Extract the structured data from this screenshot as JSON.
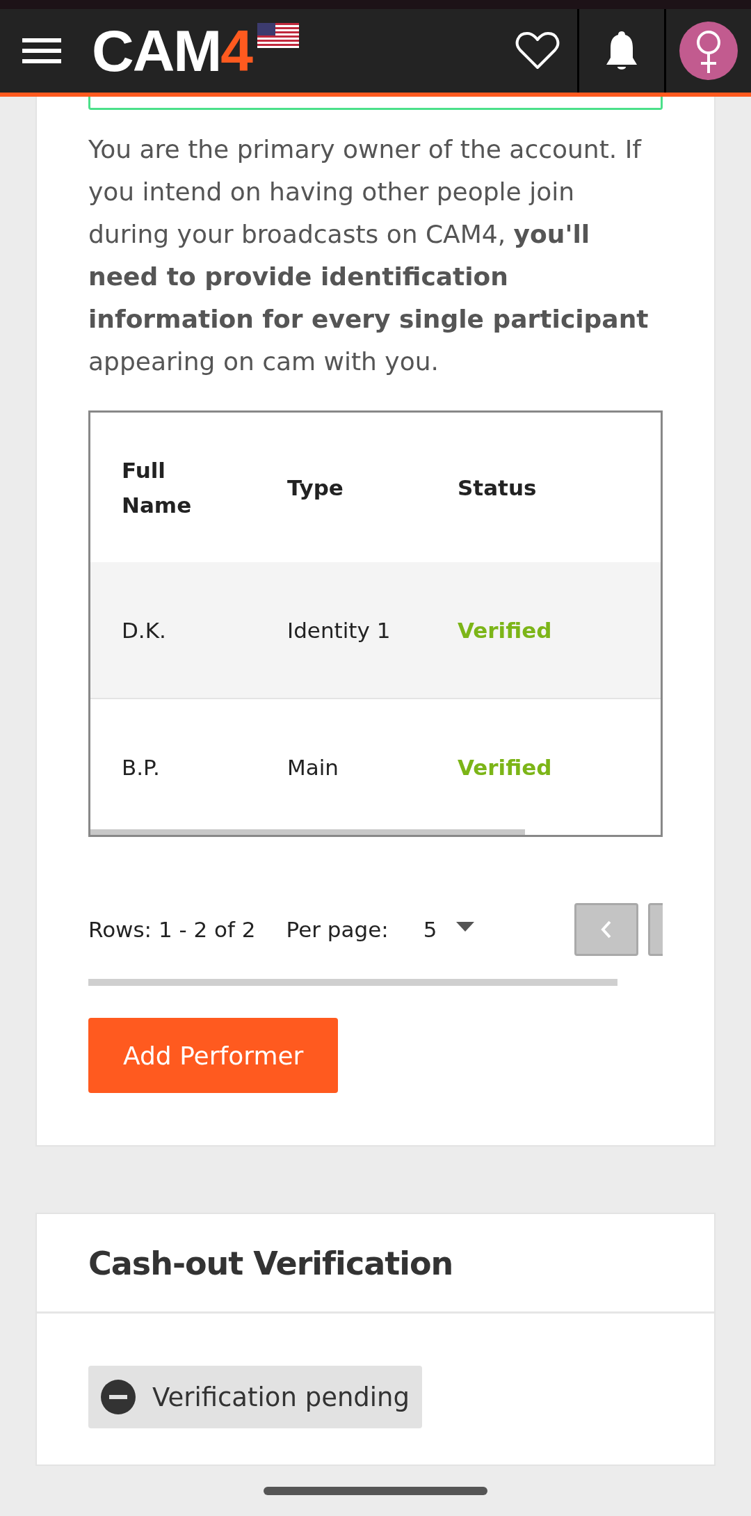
{
  "header": {
    "logo": {
      "text": "CAM",
      "accent": "4"
    }
  },
  "performers_card": {
    "intro": "You are the primary owner of the account. If you intend on having other people join during your broadcasts on CAM4, **you'll need to provide identification information for every single participant** appearing on cam with you.",
    "table": {
      "columns": [
        "Full Name",
        "Type",
        "Status"
      ],
      "rows": [
        {
          "full_name": "D.K.",
          "type": "Identity 1",
          "status": "Verified",
          "color": "#7cb518"
        },
        {
          "full_name": "B.P.",
          "type": "Main",
          "status": "Verified",
          "color": "#7cb518"
        }
      ]
    },
    "pagination": {
      "rows_label": "Rows: 1 - 2 of 2",
      "per_page_label": "Per page:",
      "per_page_value": "5"
    },
    "add_button": "Add Performer"
  },
  "cashout_card": {
    "title": "Cash-out Verification",
    "badge": "Verification pending"
  }
}
